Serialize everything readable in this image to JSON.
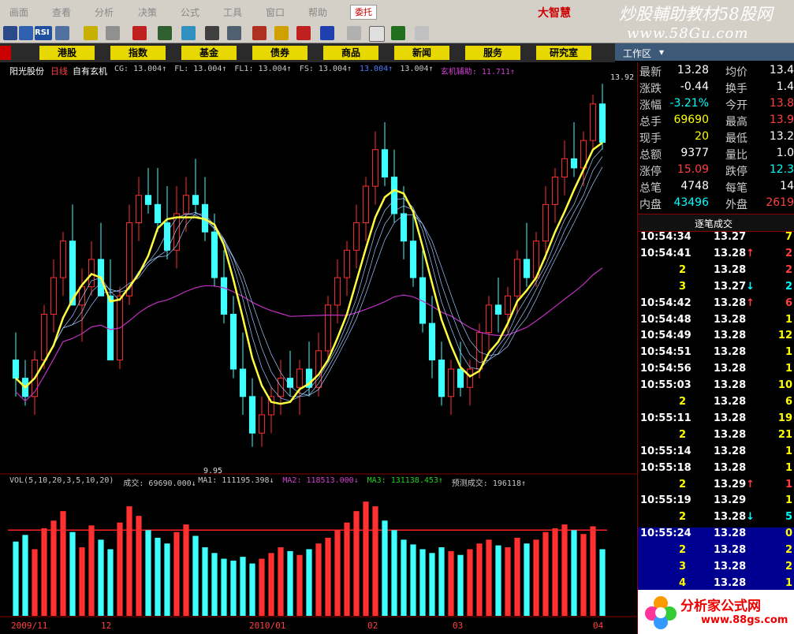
{
  "menu": [
    "画面",
    "查看",
    "分析",
    "决策",
    "公式",
    "工具",
    "窗口",
    "帮助"
  ],
  "entrust_label": "委托",
  "brand": "大智慧",
  "watermark": {
    "title": "炒股輔助教材58股网",
    "url": "www.58Gu.com",
    "footer": "分析家公式网",
    "footer_url": "www.88gs.com"
  },
  "categories": [
    "港股",
    "指数",
    "基金",
    "债券",
    "商品",
    "新闻",
    "服务",
    "研究室"
  ],
  "work_area": "工作区",
  "stock": {
    "name": "阳光股份",
    "period": "日线",
    "formula": "自有玄机"
  },
  "indicators": [
    {
      "label": "CG: 13.004↑",
      "color": "#c8c8c8"
    },
    {
      "label": "FL: 13.004↑",
      "color": "#c8c8c8"
    },
    {
      "label": "FL1: 13.004↑",
      "color": "#c8c8c8"
    },
    {
      "label": "FS: 13.004↑",
      "color": "#c8c8c8"
    },
    {
      "label": "13.004↑",
      "color": "#4a7bff"
    },
    {
      "label": "13.004↑",
      "color": "#c8c8c8"
    },
    {
      "label": "玄机辅助: 11.711↑",
      "color": "#d040d0"
    }
  ],
  "high_label": "13.92",
  "low_label": "9.95",
  "vol_header": [
    {
      "label": "VOL(5,10,20,3,5,10,20)",
      "color": "#c8c8c8"
    },
    {
      "label": "成交: 69690.000↓",
      "color": "#c8c8c8"
    },
    {
      "label": "MA1: 111195.398↓",
      "color": "#c8c8c8"
    },
    {
      "label": "MA2: 118513.000↓",
      "color": "#d040d0"
    },
    {
      "label": "MA3: 131138.453↑",
      "color": "#20d020"
    },
    {
      "label": "预测成交: 196118↑",
      "color": "#c8c8c8"
    }
  ],
  "x_axis": [
    "2009/11",
    "12",
    "2010/01",
    "02",
    "03",
    "04"
  ],
  "quote": [
    {
      "l1": "最新",
      "v1": "13.28",
      "c1": "#ffffff",
      "l2": "均价",
      "v2": "13.4",
      "c2": "#ffffff"
    },
    {
      "l1": "涨跌",
      "v1": "-0.44",
      "c1": "#ffffff",
      "l2": "换手",
      "v2": "1.4",
      "c2": "#ffffff"
    },
    {
      "l1": "涨幅",
      "v1": "-3.21%",
      "c1": "#00ffff",
      "l2": "今开",
      "v2": "13.8",
      "c2": "#ff4040"
    },
    {
      "l1": "总手",
      "v1": "69690",
      "c1": "#ffff00",
      "l2": "最高",
      "v2": "13.9",
      "c2": "#ff4040"
    },
    {
      "l1": "现手",
      "v1": "20",
      "c1": "#ffff00",
      "l2": "最低",
      "v2": "13.2",
      "c2": "#ffffff"
    },
    {
      "l1": "总额",
      "v1": "9377",
      "c1": "#ffffff",
      "l2": "量比",
      "v2": "1.0",
      "c2": "#ffffff"
    },
    {
      "l1": "涨停",
      "v1": "15.09",
      "c1": "#ff4040",
      "l2": "跌停",
      "v2": "12.3",
      "c2": "#00ffff"
    },
    {
      "l1": "总笔",
      "v1": "4748",
      "c1": "#ffffff",
      "l2": "每笔",
      "v2": "14",
      "c2": "#ffffff"
    },
    {
      "l1": "内盘",
      "v1": "43496",
      "c1": "#00ffff",
      "l2": "外盘",
      "v2": "2619",
      "c2": "#ff4040"
    }
  ],
  "trades_title": "逐笔成交",
  "trades": [
    {
      "time": "10:54:34",
      "price": "13.27",
      "arrow": "",
      "vol": "7",
      "color": "#ffff00"
    },
    {
      "time": "10:54:41",
      "price": "13.28",
      "arrow": "↑",
      "vol": "2",
      "color": "#ff4040"
    },
    {
      "time": "2",
      "price": "13.28",
      "arrow": "",
      "vol": "2",
      "color": "#ff4040"
    },
    {
      "time": "3",
      "price": "13.27",
      "arrow": "↓",
      "vol": "2",
      "color": "#00ffff"
    },
    {
      "time": "10:54:42",
      "price": "13.28",
      "arrow": "↑",
      "vol": "6",
      "color": "#ff4040"
    },
    {
      "time": "10:54:48",
      "price": "13.28",
      "arrow": "",
      "vol": "1",
      "color": "#ffff00"
    },
    {
      "time": "10:54:49",
      "price": "13.28",
      "arrow": "",
      "vol": "12",
      "color": "#ffff00"
    },
    {
      "time": "10:54:51",
      "price": "13.28",
      "arrow": "",
      "vol": "1",
      "color": "#ffff00"
    },
    {
      "time": "10:54:56",
      "price": "13.28",
      "arrow": "",
      "vol": "1",
      "color": "#ffff00"
    },
    {
      "time": "10:55:03",
      "price": "13.28",
      "arrow": "",
      "vol": "10",
      "color": "#ffff00"
    },
    {
      "time": "2",
      "price": "13.28",
      "arrow": "",
      "vol": "6",
      "color": "#ffff00"
    },
    {
      "time": "10:55:11",
      "price": "13.28",
      "arrow": "",
      "vol": "19",
      "color": "#ffff00"
    },
    {
      "time": "2",
      "price": "13.28",
      "arrow": "",
      "vol": "21",
      "color": "#ffff00"
    },
    {
      "time": "10:55:14",
      "price": "13.28",
      "arrow": "",
      "vol": "1",
      "color": "#ffff00"
    },
    {
      "time": "10:55:18",
      "price": "13.28",
      "arrow": "",
      "vol": "1",
      "color": "#ffff00"
    },
    {
      "time": "2",
      "price": "13.29",
      "arrow": "↑",
      "vol": "1",
      "color": "#ff4040"
    },
    {
      "time": "10:55:19",
      "price": "13.29",
      "arrow": "",
      "vol": "1",
      "color": "#ffff00"
    },
    {
      "time": "2",
      "price": "13.28",
      "arrow": "↓",
      "vol": "5",
      "color": "#00ffff"
    },
    {
      "time": "10:55:24",
      "price": "13.28",
      "arrow": "",
      "vol": "0",
      "color": "#ffff00"
    },
    {
      "time": "2",
      "price": "13.28",
      "arrow": "",
      "vol": "2",
      "color": "#ffff00"
    },
    {
      "time": "3",
      "price": "13.28",
      "arrow": "",
      "vol": "2",
      "color": "#ffff00"
    },
    {
      "time": "4",
      "price": "13.28",
      "arrow": "",
      "vol": "1",
      "color": "#ffff00"
    }
  ],
  "colors": {
    "up": "#ff3030",
    "down": "#40ffff",
    "ma_yellow": "#ffff40",
    "ma_purple": "#c030c0",
    "ma_fine": "#a0c8ff",
    "highlight": "#000090"
  },
  "chart_data": {
    "type": "candlestick",
    "ohlc": [
      [
        10.9,
        11.2,
        10.5,
        10.7
      ],
      [
        10.7,
        10.9,
        10.4,
        10.5
      ],
      [
        10.5,
        11.0,
        10.3,
        10.9
      ],
      [
        10.9,
        11.5,
        10.8,
        11.4
      ],
      [
        11.4,
        12.0,
        11.2,
        11.8
      ],
      [
        11.8,
        12.3,
        11.6,
        12.2
      ],
      [
        12.2,
        12.6,
        12.0,
        11.5
      ],
      [
        11.5,
        11.9,
        11.1,
        11.7
      ],
      [
        11.7,
        12.2,
        11.6,
        12.0
      ],
      [
        12.0,
        12.4,
        11.8,
        11.6
      ],
      [
        11.6,
        12.0,
        11.0,
        10.9
      ],
      [
        10.9,
        11.7,
        10.8,
        11.6
      ],
      [
        11.6,
        12.6,
        11.5,
        12.4
      ],
      [
        12.4,
        12.9,
        12.2,
        12.7
      ],
      [
        12.7,
        13.0,
        12.5,
        12.6
      ],
      [
        12.6,
        13.0,
        12.3,
        12.4
      ],
      [
        12.4,
        12.8,
        12.0,
        12.1
      ],
      [
        12.1,
        12.8,
        11.9,
        12.5
      ],
      [
        12.5,
        12.9,
        12.3,
        12.7
      ],
      [
        12.7,
        13.1,
        12.5,
        12.6
      ],
      [
        12.6,
        12.9,
        12.2,
        12.3
      ],
      [
        12.3,
        12.5,
        11.7,
        11.8
      ],
      [
        11.8,
        12.1,
        11.3,
        11.4
      ],
      [
        11.4,
        11.6,
        10.7,
        10.8
      ],
      [
        10.8,
        11.2,
        10.3,
        10.5
      ],
      [
        10.5,
        10.7,
        9.95,
        10.1
      ],
      [
        10.1,
        10.5,
        9.95,
        10.3
      ],
      [
        10.3,
        10.6,
        10.1,
        10.5
      ],
      [
        10.5,
        10.9,
        10.3,
        10.7
      ],
      [
        10.7,
        11.0,
        10.5,
        10.6
      ],
      [
        10.6,
        10.9,
        10.3,
        10.8
      ],
      [
        10.8,
        11.1,
        10.5,
        10.6
      ],
      [
        10.6,
        11.2,
        10.5,
        11.0
      ],
      [
        11.0,
        11.6,
        10.9,
        11.5
      ],
      [
        11.5,
        12.0,
        11.3,
        11.8
      ],
      [
        11.8,
        12.2,
        11.6,
        12.1
      ],
      [
        12.1,
        12.6,
        11.9,
        12.4
      ],
      [
        12.4,
        12.9,
        12.2,
        12.8
      ],
      [
        12.8,
        13.4,
        12.6,
        13.2
      ],
      [
        13.2,
        13.5,
        12.8,
        12.9
      ],
      [
        12.9,
        13.2,
        12.4,
        12.5
      ],
      [
        12.5,
        12.8,
        12.0,
        12.2
      ],
      [
        12.2,
        12.5,
        11.7,
        11.8
      ],
      [
        11.8,
        12.1,
        11.2,
        11.3
      ],
      [
        11.3,
        11.6,
        10.7,
        10.9
      ],
      [
        10.9,
        11.1,
        10.4,
        10.5
      ],
      [
        10.5,
        10.9,
        10.3,
        10.8
      ],
      [
        10.8,
        11.1,
        10.5,
        10.6
      ],
      [
        10.6,
        10.9,
        10.4,
        10.8
      ],
      [
        10.8,
        11.3,
        10.7,
        11.2
      ],
      [
        11.2,
        11.6,
        11.0,
        11.5
      ],
      [
        11.5,
        11.8,
        11.2,
        11.4
      ],
      [
        11.4,
        11.7,
        11.2,
        11.6
      ],
      [
        11.6,
        12.1,
        11.4,
        12.0
      ],
      [
        12.0,
        12.4,
        11.7,
        11.8
      ],
      [
        11.8,
        12.3,
        11.7,
        12.2
      ],
      [
        12.2,
        12.8,
        12.0,
        12.6
      ],
      [
        12.6,
        13.0,
        12.4,
        12.9
      ],
      [
        12.9,
        13.3,
        12.7,
        13.1
      ],
      [
        13.1,
        13.5,
        12.9,
        13.0
      ],
      [
        13.0,
        13.4,
        12.8,
        13.3
      ],
      [
        13.3,
        13.8,
        13.2,
        13.7
      ],
      [
        13.7,
        13.92,
        13.2,
        13.28
      ]
    ],
    "volume": [
      78,
      85,
      70,
      92,
      100,
      110,
      88,
      72,
      95,
      80,
      70,
      98,
      115,
      105,
      90,
      82,
      76,
      88,
      96,
      84,
      72,
      66,
      60,
      58,
      62,
      55,
      60,
      66,
      72,
      68,
      64,
      70,
      76,
      82,
      90,
      98,
      110,
      120,
      115,
      100,
      90,
      80,
      75,
      70,
      66,
      72,
      68,
      64,
      70,
      76,
      80,
      74,
      72,
      82,
      76,
      80,
      88,
      92,
      96,
      90,
      86,
      94,
      70
    ]
  }
}
